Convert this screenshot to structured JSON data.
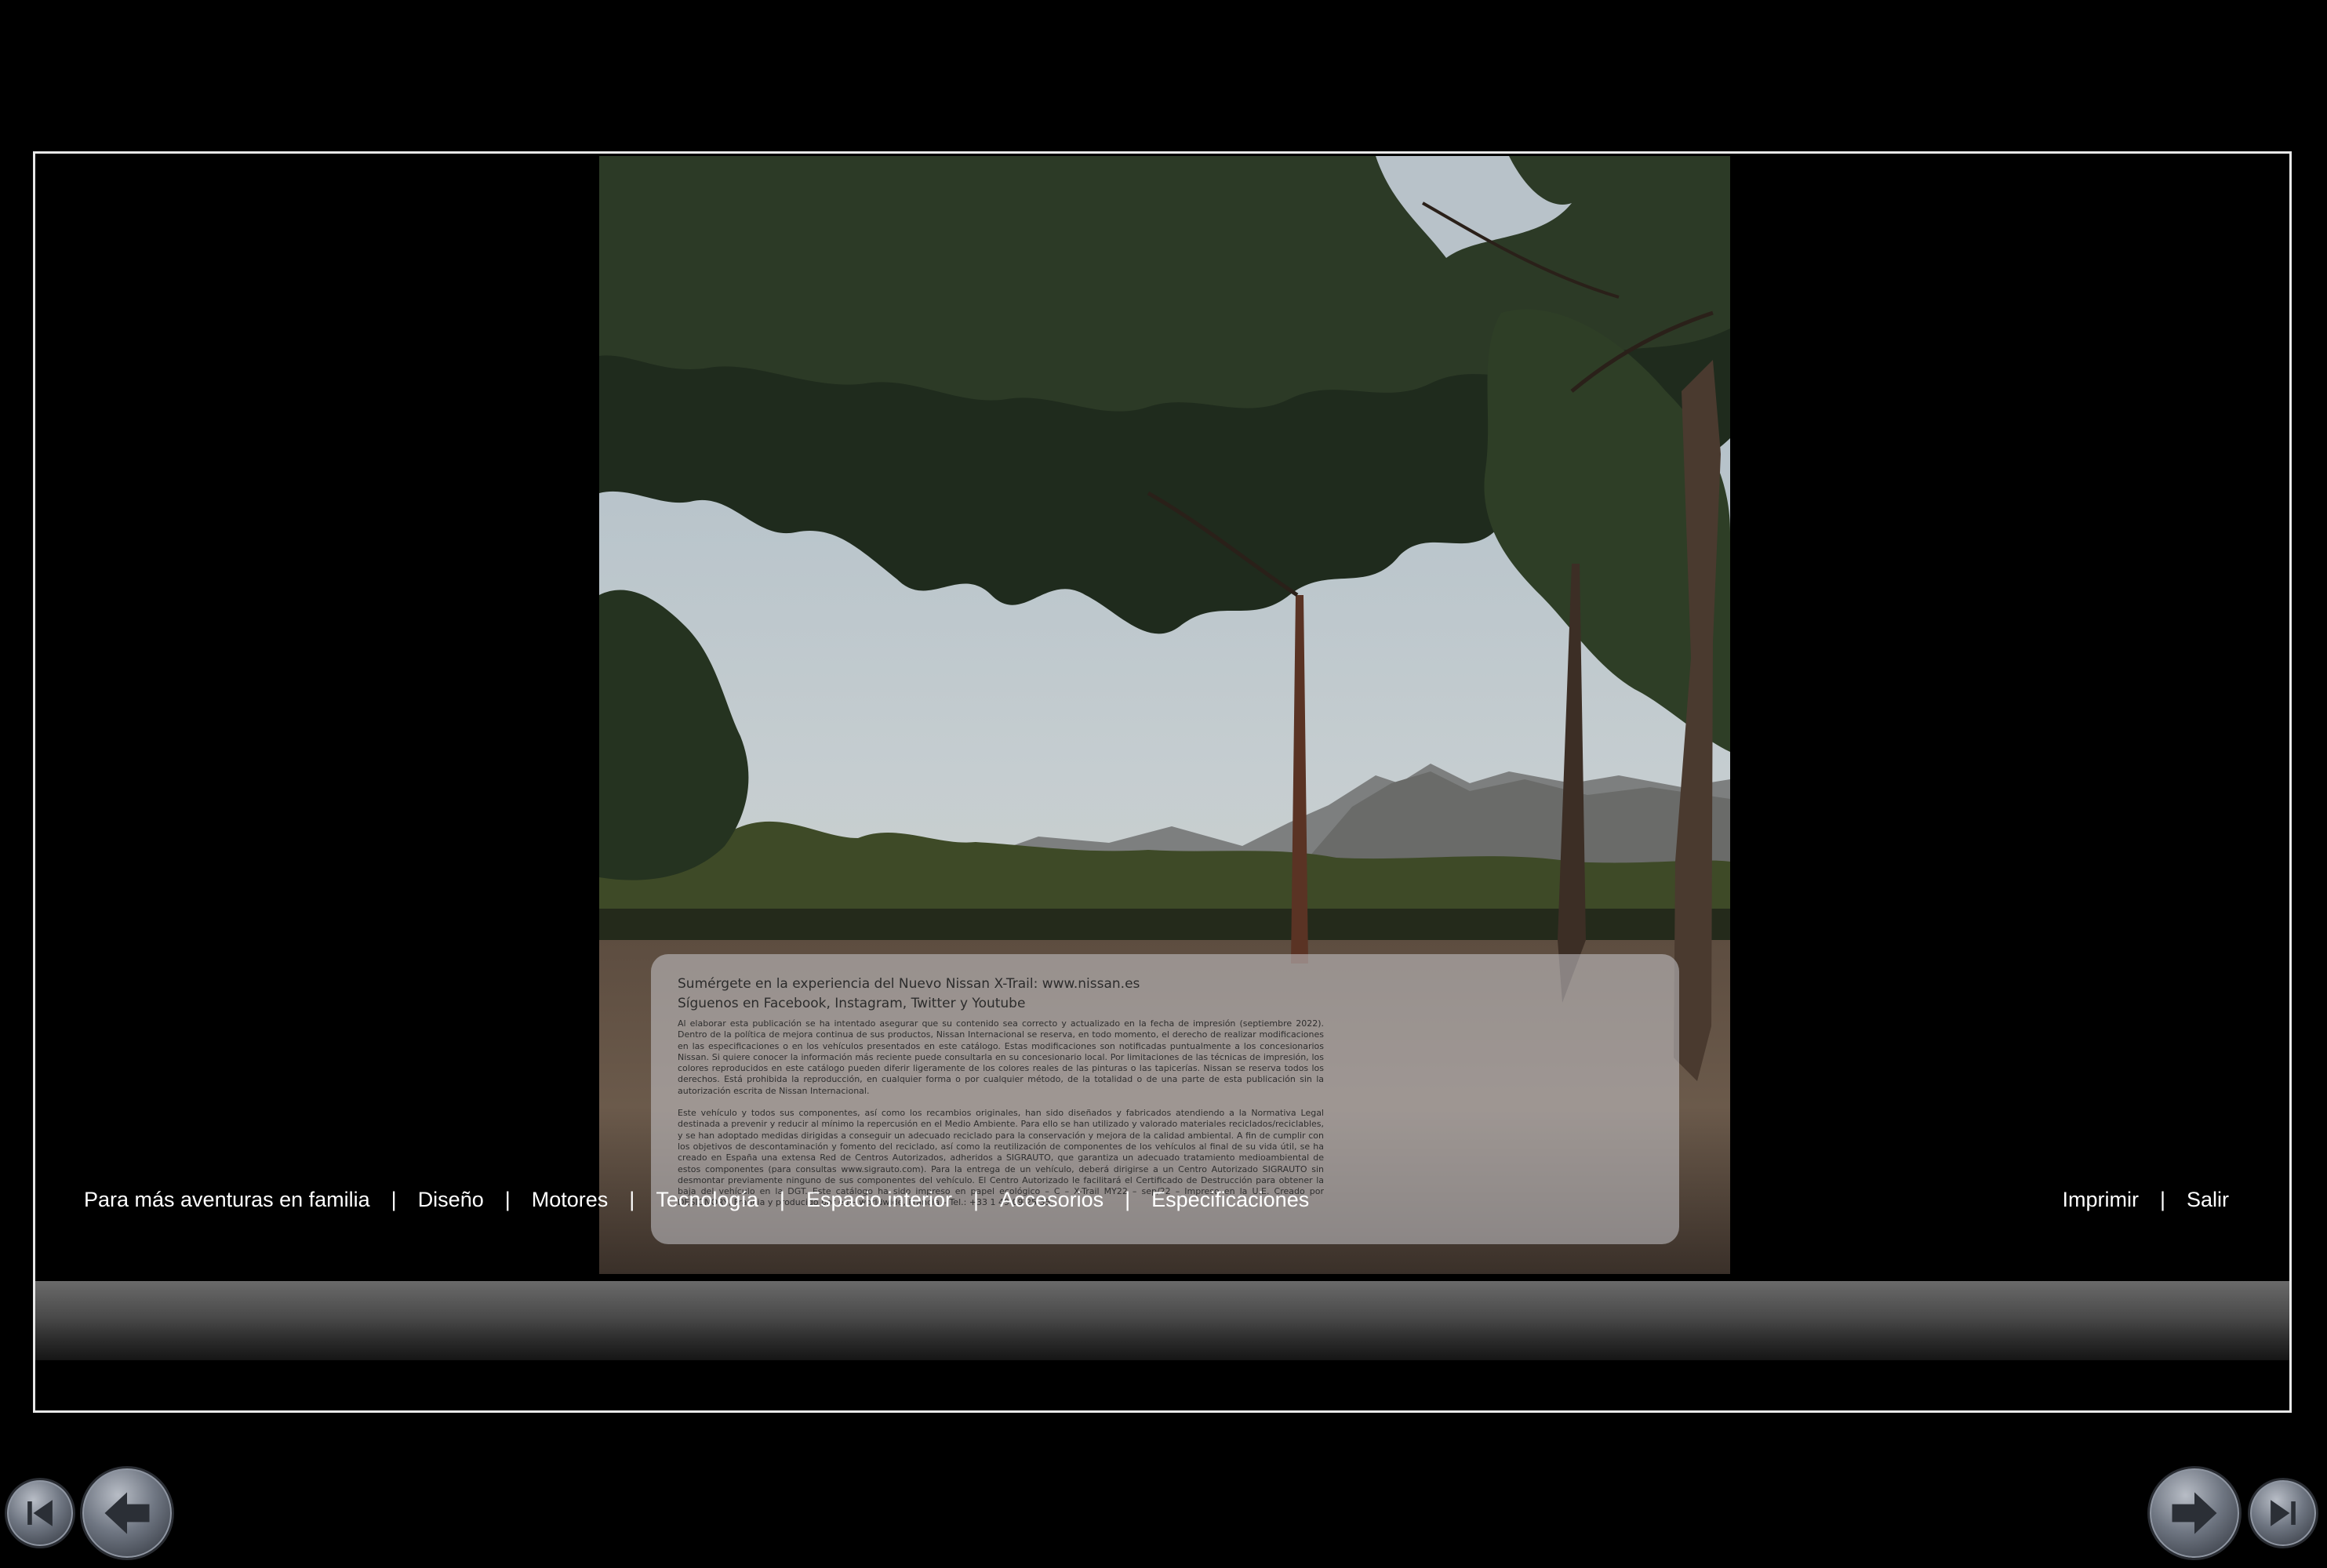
{
  "viewer": {
    "nav_links": [
      "Para más aventuras en familia",
      "Diseño",
      "Motores",
      "Tecnología",
      "Espacio interior",
      "Accesorios",
      "Especificaciones"
    ],
    "right_links": [
      "Imprimir",
      "Salir"
    ],
    "separator": "|"
  },
  "page": {
    "line1": "Sumérgete en la experiencia del Nuevo Nissan X-Trail: www.nissan.es",
    "line2": "Síguenos en Facebook, Instagram, Twitter y Youtube",
    "para1": "Al elaborar esta publicación se ha intentado asegurar que su contenido sea correcto y actualizado en la fecha de impresión (septiembre 2022). Dentro de la política de mejora continua de sus productos, Nissan Internacional se reserva, en todo momento, el derecho de realizar modificaciones en las especificaciones o en los vehículos presentados en este catálogo. Estas modificaciones son notificadas puntualmente a los concesionarios Nissan. Si quiere conocer la información más reciente puede consultarla en su concesionario local. Por limitaciones de las técnicas de impresión, los colores reproducidos en este catálogo pueden diferir ligeramente de los colores reales de las pinturas o las tapicerías. Nissan se reserva todos los derechos. Está prohibida la reproducción, en cualquier forma o por cualquier método, de la totalidad o de una parte de esta publicación sin la autorización escrita de Nissan Internacional.",
    "para2": "Este vehículo y todos sus componentes, así como los recambios originales, han sido diseñados y fabricados atendiendo a la Normativa Legal destinada a prevenir y reducir al mínimo la repercusión en el Medio Ambiente. Para ello se han utilizado y valorado materiales reciclados/reciclables, y se han adoptado medidas dirigidas a conseguir un adecuado reciclado para la conservación y mejora de la calidad ambiental. A fin de cumplir con los objetivos de descontaminación y fomento del reciclado, así como la reutilización de componentes de los vehículos al final de su vida útil, se ha creado en España una extensa Red de Centros Autorizados, adheridos a SIGRAUTO, que garantiza un adecuado tratamiento medioambiental de estos componentes (para consultas www.sigrauto.com). Para la entrega de un vehículo, deberá dirigirse a un Centro Autorizado SIGRAUTO sin desmontar previamente ninguno de sus componentes del vehículo. El Centro Autorizado le facilitará el Certificado de Destrucción para obtener la baja del vehículo en la DGT. Este catálogo ha sido impreso en papel ecológico – C – X-Trail MY22 – sep/22 – Impreso en la U.E. Creado por DESIGNORY, Francia y producido por eg+ worldwide, Francia – Tel.: +33 1 49 09 25 35."
  },
  "icons": {
    "first_page": "skip-back-icon",
    "prev_page": "arrow-left-icon",
    "next_page": "arrow-right-icon",
    "last_page": "skip-forward-icon"
  },
  "colors": {
    "background": "#000000",
    "frame_border": "#e8e8e8",
    "toolbar_top": "#6a6a6a",
    "toolbar_bottom": "#161616",
    "link_text": "#ffffff"
  }
}
